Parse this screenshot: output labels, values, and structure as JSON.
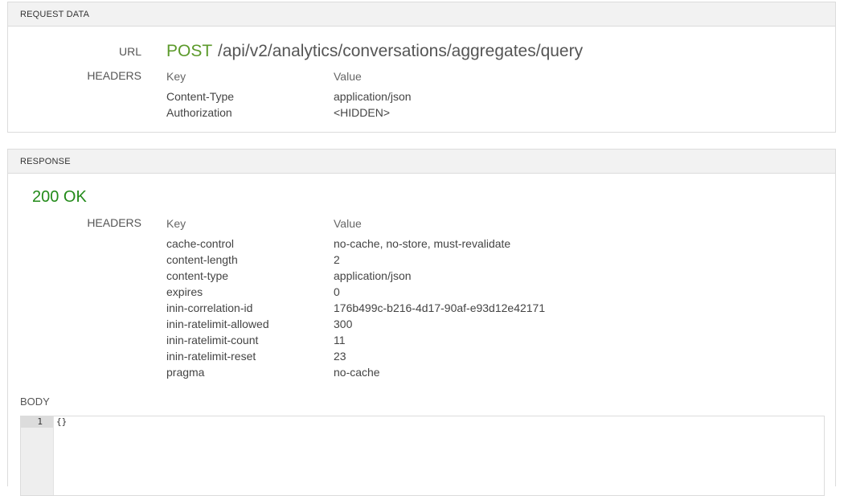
{
  "request": {
    "section_title": "REQUEST DATA",
    "url_label": "URL",
    "method": "POST",
    "path": "/api/v2/analytics/conversations/aggregates/query",
    "headers_label": "HEADERS",
    "key_col": "Key",
    "value_col": "Value",
    "headers": [
      {
        "key": "Content-Type",
        "value": "application/json"
      },
      {
        "key": "Authorization",
        "value": "<HIDDEN>"
      }
    ]
  },
  "response": {
    "section_title": "RESPONSE",
    "status": "200 OK",
    "headers_label": "HEADERS",
    "key_col": "Key",
    "value_col": "Value",
    "headers": [
      {
        "key": "cache-control",
        "value": "no-cache, no-store, must-revalidate"
      },
      {
        "key": "content-length",
        "value": "2"
      },
      {
        "key": "content-type",
        "value": "application/json"
      },
      {
        "key": "expires",
        "value": "0"
      },
      {
        "key": "inin-correlation-id",
        "value": "176b499c-b216-4d17-90af-e93d12e42171"
      },
      {
        "key": "inin-ratelimit-allowed",
        "value": "300"
      },
      {
        "key": "inin-ratelimit-count",
        "value": "11"
      },
      {
        "key": "inin-ratelimit-reset",
        "value": "23"
      },
      {
        "key": "pragma",
        "value": "no-cache"
      }
    ],
    "body_label": "BODY",
    "body_line_number": "1",
    "body_content": "{}"
  },
  "colors": {
    "method": "#5c9a2b",
    "status_ok": "#238b1a"
  }
}
